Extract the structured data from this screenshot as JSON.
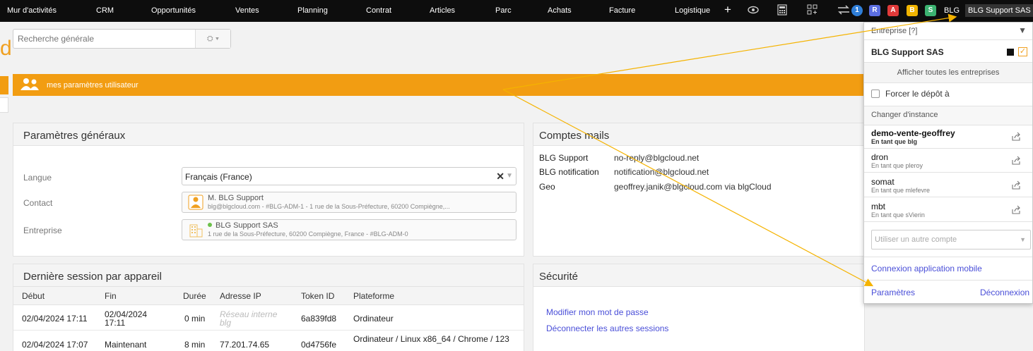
{
  "topnav": {
    "items": [
      "Mur d'activités",
      "CRM",
      "Opportunités",
      "Ventes",
      "Planning",
      "Contrat",
      "Articles",
      "Parc",
      "Achats",
      "Facture",
      "Logistique"
    ],
    "plus": "+",
    "badges": [
      {
        "label": "1",
        "color": "#2f7ed8"
      },
      {
        "label": "R",
        "color": "#5b6ee1"
      },
      {
        "label": "A",
        "color": "#e03a3a"
      },
      {
        "label": "B",
        "color": "#f0b400"
      },
      {
        "label": "S",
        "color": "#3cb371"
      }
    ],
    "user_short": "BLG",
    "company": "BLG Support SAS"
  },
  "logo_letter": "d",
  "search": {
    "placeholder": "Recherche générale",
    "filter": "⛭ ▾"
  },
  "banner": {
    "title": "mes paramètres utilisateur",
    "icon": "users-icon",
    "color": "#f29d12"
  },
  "general": {
    "title": "Paramètres généraux",
    "language_label": "Langue",
    "language_value": "Français (France)",
    "contact_label": "Contact",
    "contact_name": "M. BLG Support",
    "contact_detail": "blg@blgcloud.com - #BLG-ADM-1 - 1 rue de la Sous-Préfecture, 60200 Compiègne,...",
    "company_label": "Entreprise",
    "company_name": "BLG Support SAS",
    "company_detail": "1 rue de la Sous-Préfecture, 60200 Compiègne, France - #BLG-ADM-0"
  },
  "mail": {
    "title": "Comptes mails",
    "rows": [
      {
        "name": "BLG Support",
        "value": "no-reply@blgcloud.net"
      },
      {
        "name": "BLG notification",
        "value": "notification@blgcloud.net"
      },
      {
        "name": "Geo",
        "value": "geoffrey.janik@blgcloud.com via blgCloud"
      }
    ]
  },
  "sessions": {
    "title": "Dernière session par appareil",
    "columns": [
      "Début",
      "Fin",
      "Durée",
      "Adresse IP",
      "Token ID",
      "Plateforme"
    ],
    "rows": [
      {
        "start": "02/04/2024 17:11",
        "end": "02/04/2024 17:11",
        "duration": "0 min",
        "ip": "Réseau interne blg",
        "token": "6a839fd8",
        "platform": "Ordinateur"
      },
      {
        "start": "02/04/2024 17:07",
        "end": "Maintenant",
        "duration": "8 min",
        "ip": "77.201.74.65",
        "token": "0d4756fe",
        "platform": "Ordinateur / Linux x86_64 / Chrome / 123"
      }
    ]
  },
  "security": {
    "title": "Sécurité",
    "change_password": "Modifier mon mot de passe",
    "disconnect_others": "Déconnecter les autres sessions"
  },
  "dropdown": {
    "company_label": "Entreprise [?]",
    "company_name": "BLG Support SAS",
    "show_all": "Afficher toutes les entreprises",
    "force_depot": "Forcer le dépôt à",
    "change_instance": "Changer d'instance",
    "instances": [
      {
        "name": "demo-vente-geoffrey",
        "as": "En tant que blg"
      },
      {
        "name": "dron",
        "as": "En tant que pleroy"
      },
      {
        "name": "somat",
        "as": "En tant que mlefevre"
      },
      {
        "name": "mbt",
        "as": "En tant que sVierin"
      }
    ],
    "other_account_placeholder": "Utiliser un autre compte",
    "mobile_login": "Connexion application mobile",
    "settings": "Paramètres",
    "logout": "Déconnexion"
  },
  "colors": {
    "accent": "#f29d12",
    "link": "#4a4fd8",
    "arrow": "#f5b300"
  }
}
